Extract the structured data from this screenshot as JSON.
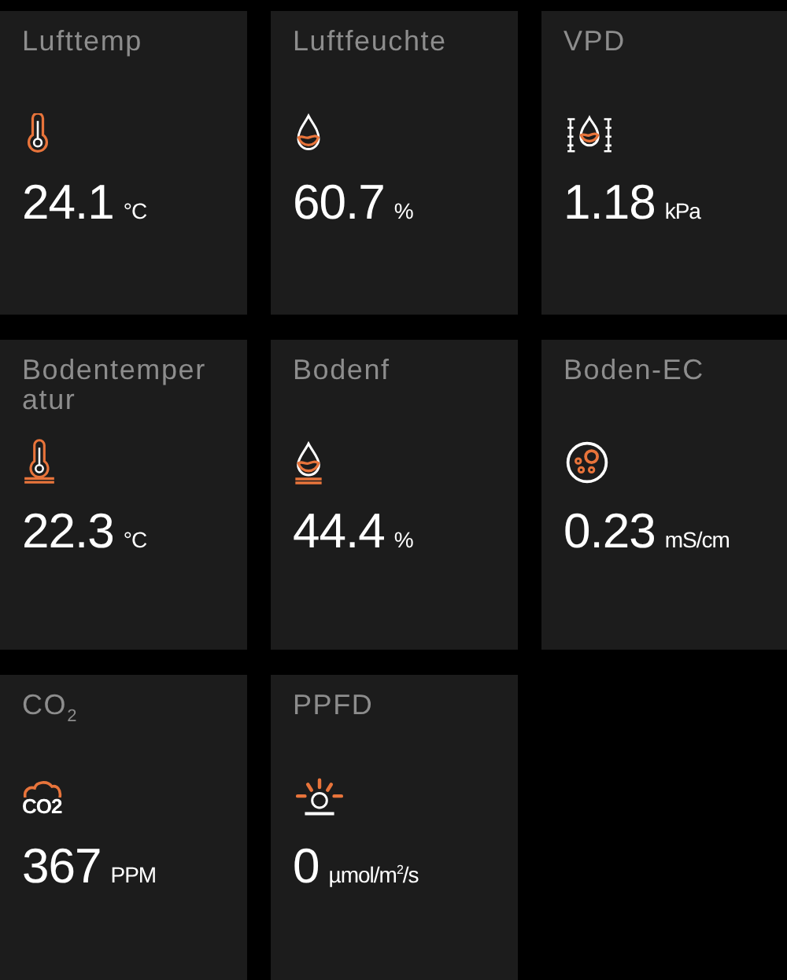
{
  "tiles": [
    {
      "label": "Lufttemp",
      "kind": "thermometer",
      "value": "24.1",
      "unit": "°C"
    },
    {
      "label": "Luftfeuchte",
      "kind": "drop",
      "value": "60.7",
      "unit": "%"
    },
    {
      "label": "VPD",
      "kind": "vpd",
      "value": "1.18",
      "unit": "kPa"
    },
    {
      "label": "Bodentemperatur",
      "kind": "soil-thermometer",
      "value": "22.3",
      "unit": "°C"
    },
    {
      "label": "Bodenf",
      "kind": "soil-drop",
      "value": "44.4",
      "unit": "%"
    },
    {
      "label": "Boden-EC",
      "kind": "ec",
      "value": "0.23",
      "unit": "mS/cm"
    },
    {
      "label": "CO$_{2}$",
      "kind": "co2",
      "icon_text": "CO2",
      "value": "367",
      "unit": "PPM"
    },
    {
      "label": "PPFD",
      "kind": "light",
      "value": "0",
      "unit": "µmol/m$^{2}$/s"
    }
  ]
}
